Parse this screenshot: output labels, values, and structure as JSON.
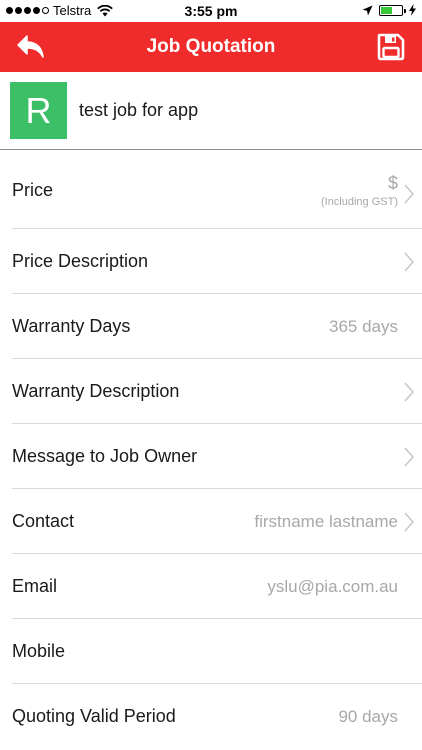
{
  "status_bar": {
    "carrier": "Telstra",
    "time": "3:55 pm",
    "battery_color": "#37c837"
  },
  "nav": {
    "title": "Job Quotation",
    "background": "#f02b2b",
    "back_icon": "back-arrow-icon",
    "save_icon": "floppy-disk-icon"
  },
  "job": {
    "avatar_letter": "R",
    "avatar_color": "#3cbf66",
    "title": "test job for app"
  },
  "rows": {
    "price": {
      "label": "Price",
      "value": "$",
      "note": "(Including GST)"
    },
    "price_description": {
      "label": "Price Description"
    },
    "warranty_days": {
      "label": "Warranty Days",
      "value": "365 days"
    },
    "warranty_description": {
      "label": "Warranty Description"
    },
    "message": {
      "label": "Message to Job Owner"
    },
    "contact": {
      "label": "Contact",
      "value": "firstname lastname"
    },
    "email": {
      "label": "Email",
      "value": "yslu@pia.com.au"
    },
    "mobile": {
      "label": "Mobile",
      "value": ""
    },
    "quoting_valid_period": {
      "label": "Quoting Valid Period",
      "value": "90 days"
    }
  }
}
